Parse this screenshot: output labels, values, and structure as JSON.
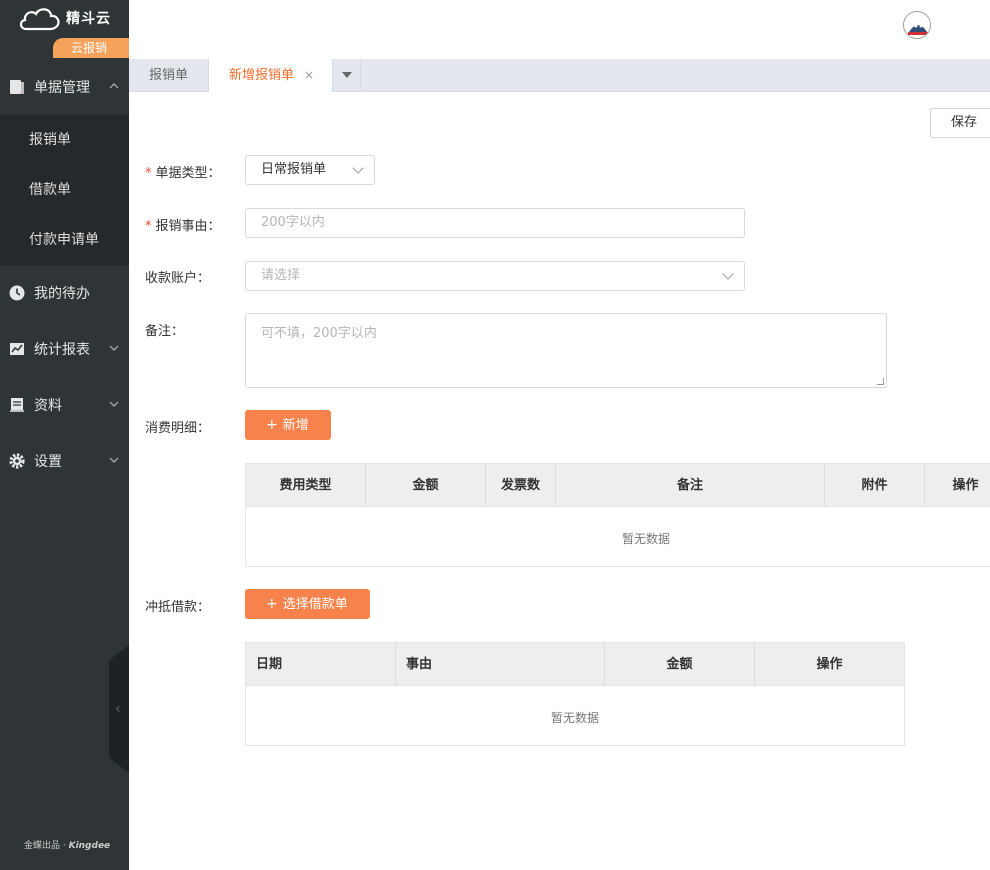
{
  "sidebar": {
    "logo_text": "精斗云",
    "logo_badge": "云报销",
    "groups": [
      {
        "label": "单据管理",
        "items": [
          "报销单",
          "借款单",
          "付款申请单"
        ]
      },
      {
        "label": "我的待办"
      },
      {
        "label": "统计报表"
      },
      {
        "label": "资料"
      },
      {
        "label": "设置"
      }
    ],
    "footer_prefix": "金蝶出品 · ",
    "footer_brand": "Kingdee"
  },
  "tabs": {
    "items": [
      "报销单",
      "新增报销单"
    ],
    "close": "×"
  },
  "toolbar": {
    "save_label": "保存"
  },
  "form": {
    "doc_type": {
      "label": "单据类型：",
      "value": "日常报销单"
    },
    "reason": {
      "label": "报销事由：",
      "placeholder": "200字以内"
    },
    "account": {
      "label": "收款账户：",
      "placeholder": "请选择"
    },
    "note": {
      "label": "备注：",
      "placeholder": "可不填，200字以内"
    },
    "expense": {
      "label": "消费明细：",
      "add_label": "新增",
      "columns": [
        "费用类型",
        "金额",
        "发票数",
        "备注",
        "附件",
        "操作"
      ],
      "empty": "暂无数据"
    },
    "offset": {
      "label": "冲抵借款：",
      "select_label": "选择借款单",
      "columns": [
        "日期",
        "事由",
        "金额",
        "操作"
      ],
      "empty": "暂无数据"
    }
  },
  "colors": {
    "accent": "#f7824b",
    "sidebar_bg": "#2f3437",
    "active_tab": "#f26e2e"
  }
}
